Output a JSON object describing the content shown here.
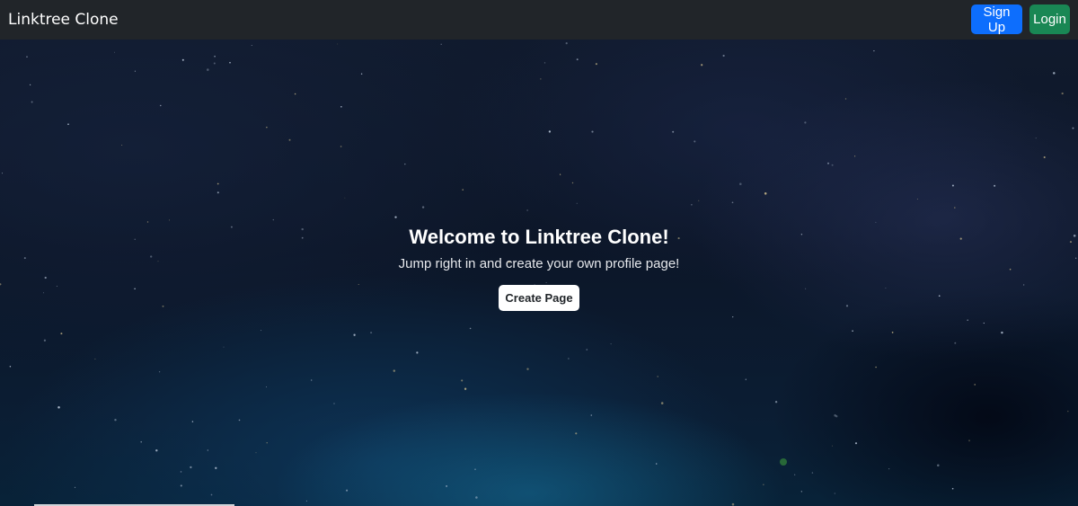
{
  "navbar": {
    "brand": "Linktree Clone",
    "signup_label": "Sign Up",
    "login_label": "Login"
  },
  "hero": {
    "title": "Welcome to Linktree Clone!",
    "subtitle": "Jump right in and create your own profile page!",
    "cta_label": "Create Page"
  },
  "colors": {
    "navbar_bg": "#212529",
    "signup_bg": "#0d6efd",
    "login_bg": "#198754",
    "cta_bg": "#ffffff"
  }
}
